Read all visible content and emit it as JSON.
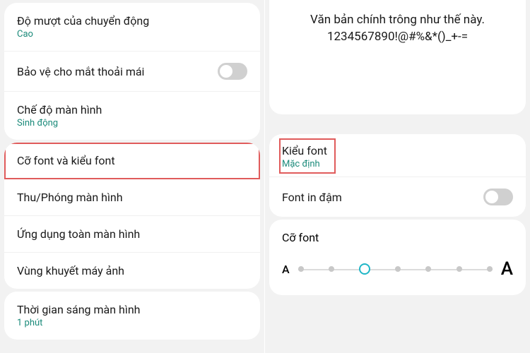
{
  "left": {
    "group1": {
      "motion": {
        "title": "Độ mượt của chuyển động",
        "sub": "Cao"
      },
      "eyeComfort": {
        "title": "Bảo vệ cho mắt thoải mái"
      },
      "screenMode": {
        "title": "Chế độ màn hình",
        "sub": "Sinh động"
      }
    },
    "group2": {
      "fontStyle": {
        "title": "Cỡ font và kiểu font"
      },
      "zoom": {
        "title": "Thu/Phóng màn hình"
      },
      "fullscreen": {
        "title": "Ứng dụng toàn màn hình"
      },
      "cutout": {
        "title": "Vùng khuyết máy ảnh"
      }
    },
    "group3": {
      "timeout": {
        "title": "Thời gian sáng màn hình",
        "sub": "1 phút"
      }
    }
  },
  "right": {
    "preview": {
      "line1": "Văn bản chính trông như thế này.",
      "line2": "1234567890!@#%&*()_+-="
    },
    "fontStyle": {
      "title": "Kiểu font",
      "sub": "Mặc định"
    },
    "bold": {
      "title": "Font in đậm"
    },
    "size": {
      "heading": "Cỡ font",
      "smallA": "A",
      "bigA": "A",
      "steps": 7,
      "active": 2
    }
  }
}
